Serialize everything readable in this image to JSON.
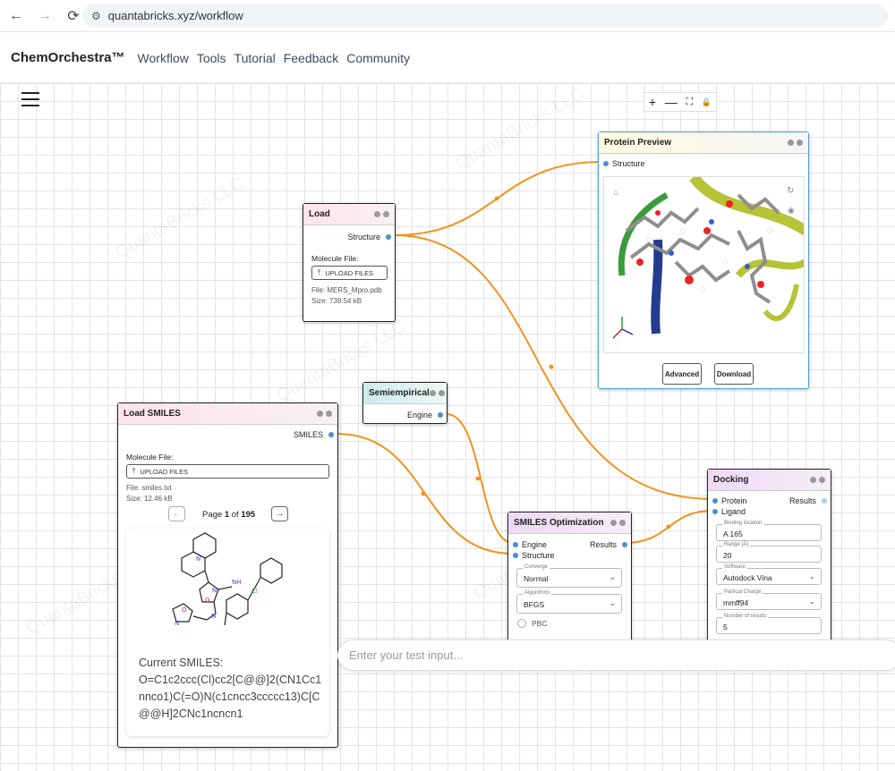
{
  "browser": {
    "url": "quantabricks.xyz/workflow",
    "back_glyph": "←",
    "forward_glyph": "→",
    "reload_glyph": "⟳",
    "tune_glyph": "⚙"
  },
  "header": {
    "brand": "ChemOrchestra™",
    "nav": [
      "Workflow",
      "Tools",
      "Tutorial",
      "Feedback",
      "Community"
    ]
  },
  "zoom_controls": {
    "zoom_in": "+",
    "zoom_out": "—",
    "fit": "⛶",
    "lock": "🔒"
  },
  "nodes": {
    "load": {
      "title": "Load",
      "output_port": "Structure",
      "field_label": "Molecule File:",
      "upload_label": "UPLOAD FILES",
      "file": "File: MERS_Mpro.pdb",
      "size": "Size: 739.54 kB"
    },
    "protein_preview": {
      "title": "Protein Preview",
      "input_port": "Structure",
      "advanced_label": "Advanced",
      "download_label": "Download"
    },
    "semiempirical": {
      "title": "Semiempirical",
      "output_port": "Engine"
    },
    "load_smiles": {
      "title": "Load SMILES",
      "output_port": "SMILES",
      "field_label": "Molecule File:",
      "upload_label": "UPLOAD FILES",
      "file": "File: smiles.txt",
      "size": "Size: 12.46 kB",
      "page_prefix": "Page",
      "page_current": "1",
      "page_of": "of",
      "page_total": "195",
      "current_label": "Current SMILES:",
      "smiles_lines": [
        "O=C1c2ccc(Cl)cc2[C@@]2(CN1Cc1",
        "nnco1)C(=O)N(c1cncc3ccccc13)C[C",
        "@@H]2CNc1ncncn1"
      ],
      "prev_glyph": "←",
      "next_glyph": "→",
      "mol_labels": {
        "N1": "N",
        "O1": "O",
        "N2": "N",
        "NH": "NH",
        "N3": "N",
        "O2": "O",
        "N4": "N",
        "Cl": "Cl"
      }
    },
    "smiles_optimization": {
      "title": "SMILES Optimization",
      "input_ports": [
        "Engine",
        "Structure"
      ],
      "output_port": "Results",
      "converge": {
        "label": "Converge",
        "value": "Normal"
      },
      "algorithms": {
        "label": "Algorithms",
        "value": "BFGS"
      },
      "pbc_label": "PBC"
    },
    "docking": {
      "title": "Docking",
      "input_ports": [
        "Protein",
        "Ligand"
      ],
      "output_port": "Results",
      "binding": {
        "label": "Binding location",
        "value": "A 165"
      },
      "range": {
        "label": "Range (Å)",
        "value": "20"
      },
      "software": {
        "label": "Software",
        "value": "Autodock Vina"
      },
      "charge": {
        "label": "Partical Charge",
        "value": "mmff94"
      },
      "num_results": {
        "label": "Number of results",
        "value": "5"
      }
    }
  },
  "test_input": {
    "placeholder": "Enter your test input..."
  },
  "watermark": "QuantaBricks LLC",
  "colors": {
    "edge": "#f0931e",
    "port": "#4a8fd0",
    "accent_border": "#4a9fd6"
  }
}
